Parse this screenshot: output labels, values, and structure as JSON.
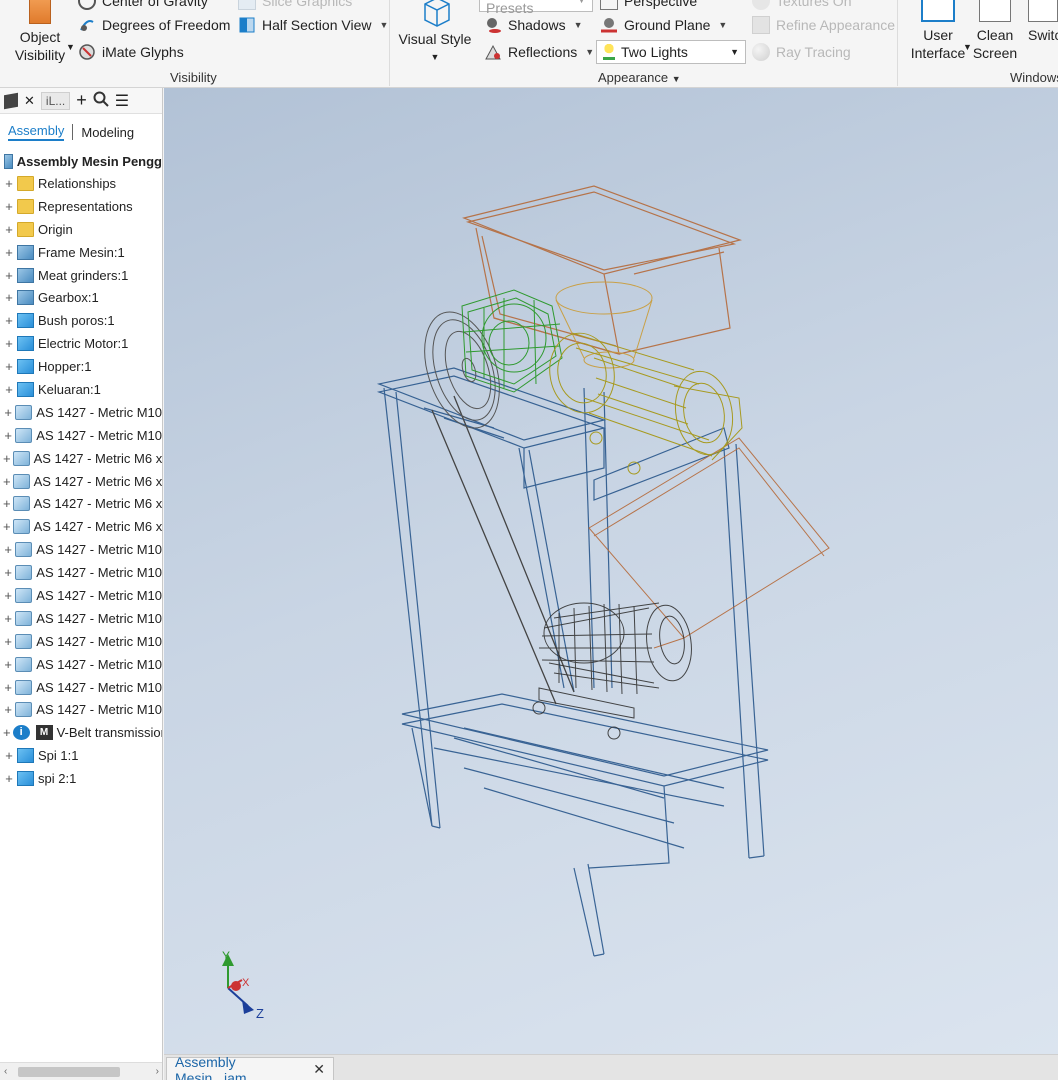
{
  "ribbon": {
    "visibility": {
      "object_visibility": "Object\nVisibility",
      "center_of_gravity": "Center of Gravity",
      "degrees_of_freedom": "Degrees of Freedom",
      "imate_glyphs": "iMate Glyphs",
      "slice_graphics": "Slice Graphics",
      "half_section_view": "Half Section View",
      "group_label": "Visibility"
    },
    "appearance": {
      "visual_style": "Visual Style",
      "visual_presets": "Visual Presets",
      "perspective": "Perspective",
      "shadows": "Shadows",
      "ground_plane": "Ground Plane",
      "reflections": "Reflections",
      "lighting_value": "Two Lights",
      "textures_on": "Textures On",
      "refine_appearance": "Refine Appearance",
      "ray_tracing": "Ray Tracing",
      "group_label": "Appearance"
    },
    "windows": {
      "user_interface": "User\nInterface",
      "clean_screen": "Clean\nScreen",
      "switch": "Switch",
      "group_label": "Windows"
    }
  },
  "browser": {
    "tab_short": "iL...",
    "tabs": [
      "Assembly",
      "Modeling"
    ],
    "root": "Assembly Mesin Pengg",
    "items": [
      {
        "label": "Relationships",
        "icon": "folder"
      },
      {
        "label": "Representations",
        "icon": "folder"
      },
      {
        "label": "Origin",
        "icon": "folder"
      },
      {
        "label": "Frame Mesin:1",
        "icon": "assy"
      },
      {
        "label": "Meat grinders:1",
        "icon": "assy"
      },
      {
        "label": "Gearbox:1",
        "icon": "assy"
      },
      {
        "label": "Bush poros:1",
        "icon": "part"
      },
      {
        "label": "Electric Motor:1",
        "icon": "part"
      },
      {
        "label": "Hopper:1",
        "icon": "part"
      },
      {
        "label": "Keluaran:1",
        "icon": "part"
      },
      {
        "label": "AS 1427 - Metric M10",
        "icon": "bolt"
      },
      {
        "label": "AS 1427 - Metric M10",
        "icon": "bolt"
      },
      {
        "label": "AS 1427 - Metric M6 x",
        "icon": "bolt"
      },
      {
        "label": "AS 1427 - Metric M6 x",
        "icon": "bolt"
      },
      {
        "label": "AS 1427 - Metric M6 x",
        "icon": "bolt"
      },
      {
        "label": "AS 1427 - Metric M6 x",
        "icon": "bolt"
      },
      {
        "label": "AS 1427 - Metric M10",
        "icon": "bolt"
      },
      {
        "label": "AS 1427 - Metric M10",
        "icon": "bolt"
      },
      {
        "label": "AS 1427 - Metric M10",
        "icon": "bolt"
      },
      {
        "label": "AS 1427 - Metric M10",
        "icon": "bolt"
      },
      {
        "label": "AS 1427 - Metric M10",
        "icon": "bolt"
      },
      {
        "label": "AS 1427 - Metric M10",
        "icon": "bolt"
      },
      {
        "label": "AS 1427 - Metric M10",
        "icon": "bolt"
      },
      {
        "label": "AS 1427 - Metric M10",
        "icon": "bolt"
      },
      {
        "label": "V-Belt transmission",
        "icon": "vbelt"
      },
      {
        "label": "Spi 1:1",
        "icon": "part"
      },
      {
        "label": "spi 2:1",
        "icon": "part"
      }
    ]
  },
  "axis": {
    "x": "X",
    "y": "Y",
    "z": "Z"
  },
  "document_tab": "Assembly Mesin...iam",
  "colors": {
    "accent": "#1c7ec9",
    "frame": "#1f4f86",
    "gearbox": "#2f9a2f",
    "grinder": "#a79a1f",
    "hopper": "#b56a3a",
    "motor": "#333333"
  }
}
